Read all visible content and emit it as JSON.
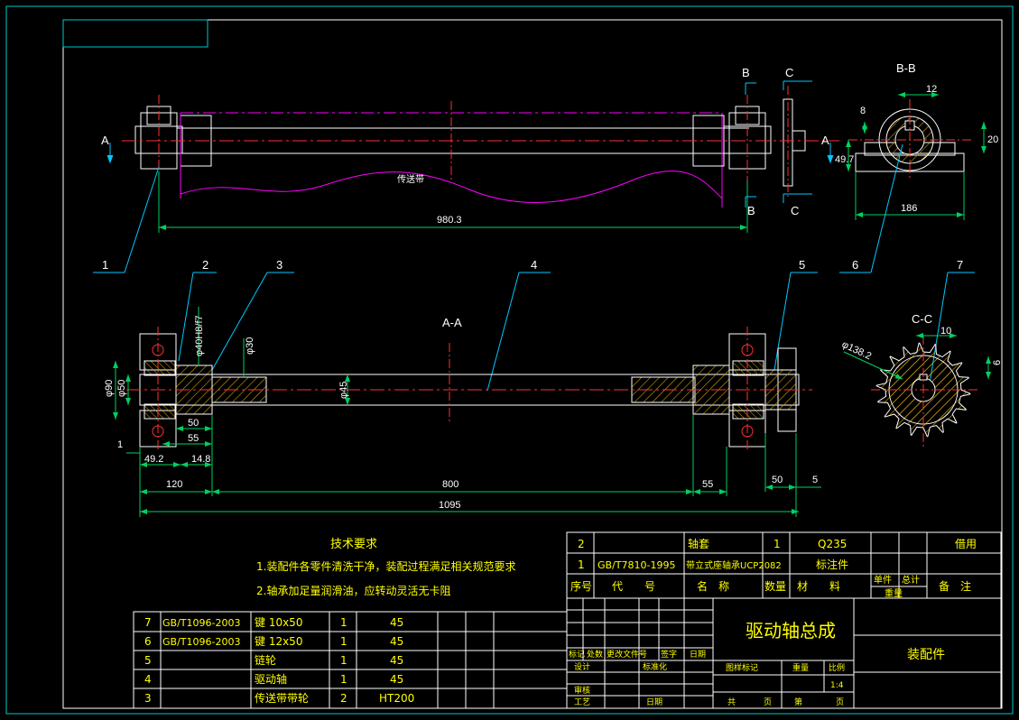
{
  "colors": {
    "background": "#000000",
    "frame": "#00c8c8",
    "outline": "#ffffff",
    "dim": "#00d060",
    "centerline": "#ff3030",
    "belt": "#ff00ff",
    "leader": "#00c8ff",
    "hatch": "#d4a000",
    "text": "#ffffff",
    "green_text": "#00ff00",
    "yellow": "#ffff00"
  },
  "views": {
    "top": {
      "section_a": "A",
      "section_a2": "A",
      "section_b": "B",
      "section_b2": "B",
      "section_c": "C",
      "section_c2": "C",
      "belt_label": "传送带",
      "dim_length": "980.3"
    },
    "bb": {
      "title": "B-B",
      "dim_12": "12",
      "dim_8": "8",
      "dim_49_7": "49.7",
      "dim_20": "20",
      "dim_186": "186"
    },
    "aa": {
      "title": "A-A",
      "dim_40": "φ40H8/f7",
      "dim_30": "φ30",
      "dim_90": "φ90",
      "dim_50d": "φ50",
      "dim_45": "φ45",
      "dim_50": "50",
      "dim_55a": "55",
      "dim_1": "1",
      "dim_49_2": "49.2",
      "dim_14_8": "14.8",
      "dim_120": "120",
      "dim_800": "800",
      "dim_55b": "55",
      "dim_50b": "50",
      "dim_5": "5",
      "dim_1095": "1095"
    },
    "cc": {
      "title": "C-C",
      "dim_10": "10",
      "dim_138": "φ138.2",
      "dim_6": "6"
    }
  },
  "balloons": [
    "1",
    "2",
    "3",
    "4",
    "5",
    "6",
    "7"
  ],
  "notes": {
    "title": "技术要求",
    "line1": "1.装配件各零件清洗干净，装配过程满足相关规范要求",
    "line2": "2.轴承加足量润滑油，应转动灵活无卡阻"
  },
  "bom_upper": [
    {
      "no": "2",
      "code": "",
      "name": "轴套",
      "qty": "1",
      "material": "Q235",
      "remark": "借用"
    },
    {
      "no": "1",
      "code": "GB/T7810-1995",
      "name": "带立式座轴承UCP2082",
      "qty": "",
      "material": "标注件",
      "remark": ""
    }
  ],
  "bom_header": {
    "no": "序号",
    "code": "代　　号",
    "name": "名　称",
    "qty": "数量",
    "material": "材　　料",
    "unit_weight": "单件",
    "total_weight": "总计",
    "weight": "重量",
    "remark": "备　注"
  },
  "bom_lower": [
    {
      "no": "7",
      "code": "GB/T1096-2003",
      "name": "键 10x50",
      "qty": "1",
      "material": "45"
    },
    {
      "no": "6",
      "code": "GB/T1096-2003",
      "name": "键 12x50",
      "qty": "1",
      "material": "45"
    },
    {
      "no": "5",
      "code": "",
      "name": "链轮",
      "qty": "1",
      "material": "45"
    },
    {
      "no": "4",
      "code": "",
      "name": "驱动轴",
      "qty": "1",
      "material": "45"
    },
    {
      "no": "3",
      "code": "",
      "name": "传送带带轮",
      "qty": "2",
      "material": "HT200"
    }
  ],
  "title_block": {
    "drawing_name": "驱动轴总成",
    "type": "装配件",
    "rev_mark": "标记",
    "rev_count": "处数",
    "rev_doc": "更改文件号",
    "rev_sign": "签字",
    "rev_date": "日期",
    "designer": "设计",
    "standardize": "标准化",
    "review": "审核",
    "process": "工艺",
    "date": "日期",
    "stage": "图样标记",
    "weight": "重量",
    "scale_label": "比例",
    "scale": "1:4",
    "total": "共",
    "sheet_unit": "页",
    "sheet": "第",
    "page": "页"
  }
}
